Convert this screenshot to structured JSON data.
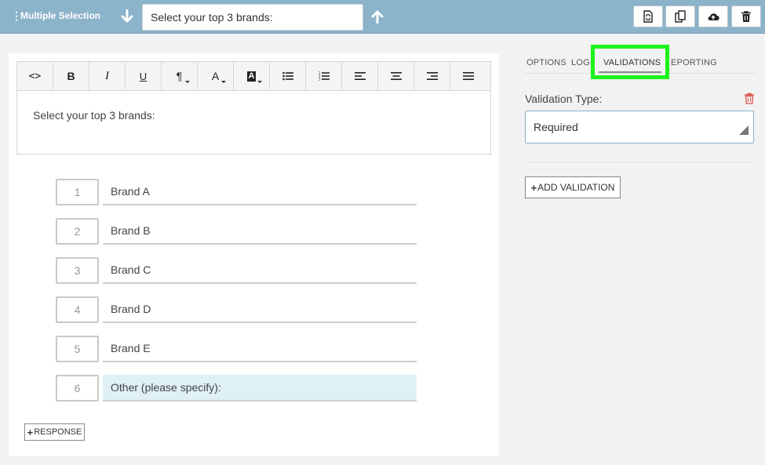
{
  "header": {
    "question_type": "Multiple Selection",
    "question_text": "Select your top 3 brands:"
  },
  "toolbar": {
    "tools": [
      "code",
      "bold",
      "italic",
      "underline",
      "paragraph",
      "font-color",
      "background-color",
      "bullet-list",
      "numbered-list",
      "align-left",
      "align-center",
      "align-right",
      "justify"
    ]
  },
  "editor": {
    "text": "Select your top 3 brands:"
  },
  "responses": [
    {
      "number": "1",
      "label": "Brand A"
    },
    {
      "number": "2",
      "label": "Brand B"
    },
    {
      "number": "3",
      "label": "Brand C"
    },
    {
      "number": "4",
      "label": "Brand D"
    },
    {
      "number": "5",
      "label": "Brand E"
    },
    {
      "number": "6",
      "label": "Other (please specify):"
    }
  ],
  "add_response_label": "RESPONSE",
  "panel": {
    "tabs": [
      "OPTIONS",
      "LOGI",
      "VALIDATIONS",
      "EPORTING"
    ],
    "active_tab": "VALIDATIONS",
    "validation_type_label": "Validation Type:",
    "validation_type_value": "Required",
    "add_validation_label": "ADD VALIDATION"
  },
  "colors": {
    "topbar": "#8bb3c9",
    "highlight": "#1ef21e",
    "delete": "#d9534f",
    "response_highlight": "#dff0f7"
  }
}
